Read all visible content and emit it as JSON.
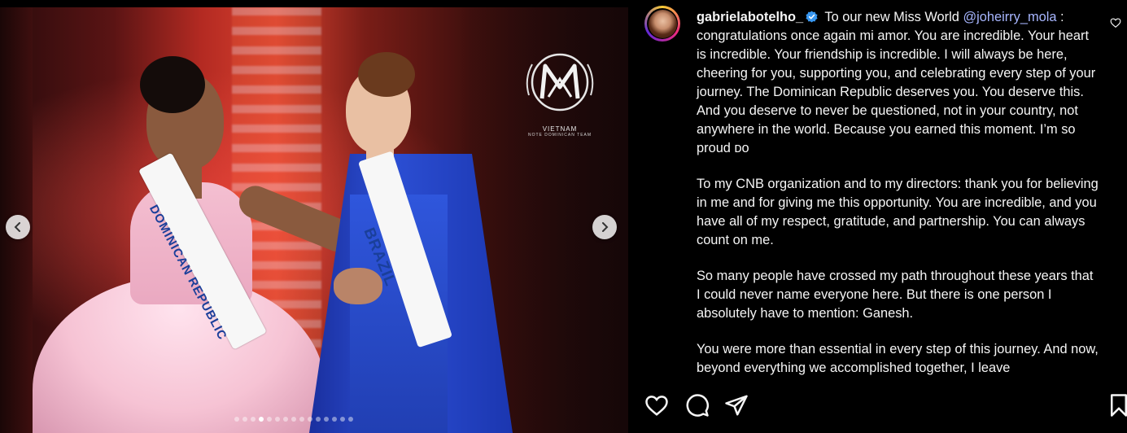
{
  "post": {
    "username": "gabrielabotelho_",
    "verified": true,
    "caption_lead": " To our new Miss World ",
    "mention": "@joheirry_mola",
    "caption_rest": " : congratulations once again mi amor. You are incredible. Your heart is incredible. Your friendship is incredible. I will always be here, cheering for you, supporting you, and celebrating every step of your journey. The Dominican Republic deserves you. You deserve this. And you deserve to never be questioned, not in your country, not anywhere in the world. Because you earned this moment. I’m so proud ᴅᴏ",
    "paragraphs": [
      "To my CNB organization and to my directors: thank you for believing in me and for giving me this opportunity. You are incredible, and you have all of my respect, gratitude, and partnership. You can always count on me.",
      "So many people have crossed my path throughout these years that I could never name everyone here. But there is one person I absolutely have to mention: Ganesh.",
      "You were more than essential in every step of this journey. And now, beyond everything we accomplished together, I leave"
    ]
  },
  "media": {
    "sash_left_text": "DOMINICAN REPUBLIC",
    "sash_right_text": "BRAZIL",
    "logo_line1": "VIETNAM",
    "logo_line2": "NOTE DOMINICAN TEAM",
    "carousel_total": 15,
    "carousel_active_index": 3
  },
  "icons": {
    "prev": "chevron-left-icon",
    "next": "chevron-right-icon",
    "like": "heart-icon",
    "comment": "comment-icon",
    "share": "share-icon",
    "save": "bookmark-icon"
  },
  "colors": {
    "background": "#000000",
    "text": "#f5f5f5",
    "mention": "#a7b6ff",
    "verified": "#3897f0"
  }
}
